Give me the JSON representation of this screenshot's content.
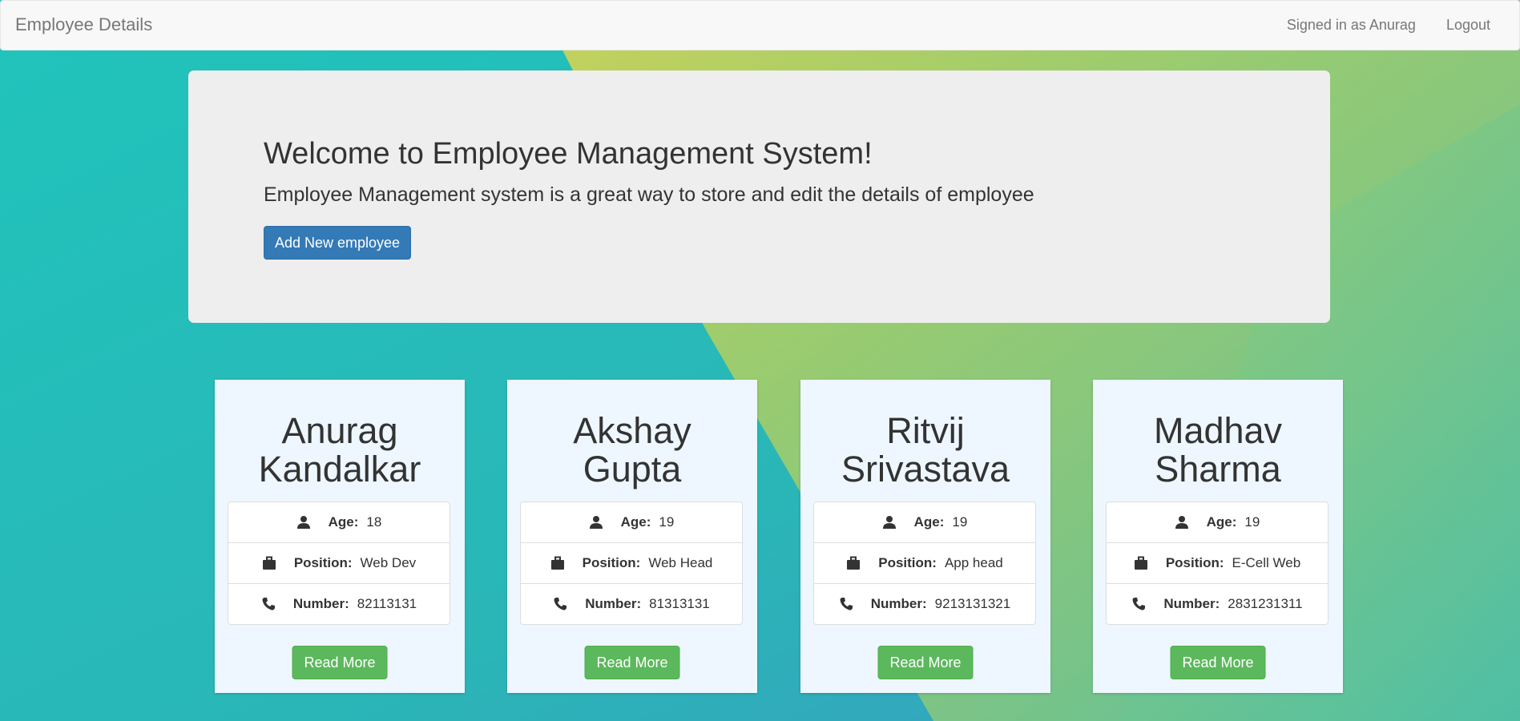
{
  "navbar": {
    "brand": "Employee Details",
    "signed_in": "Signed in as Anurag",
    "logout": "Logout"
  },
  "jumbotron": {
    "title": "Welcome to Employee Management System!",
    "subtitle": "Employee Management system is a great way to store and edit the details of employee",
    "add_button": "Add New employee"
  },
  "labels": {
    "age": "Age:",
    "position": "Position:",
    "number": "Number:",
    "read_more": "Read More"
  },
  "icons": {
    "age": "user-icon",
    "position": "briefcase-icon",
    "number": "phone-icon"
  },
  "colors": {
    "primary": "#337ab7",
    "success": "#5cb85c",
    "card_bg": "#eef7ff",
    "teal": "#24c1bb",
    "green": "#8ac77c"
  },
  "employees": [
    {
      "first_name": "Anurag",
      "last_name": "Kandalkar",
      "age": "18",
      "position": "Web Dev",
      "number": "82113131"
    },
    {
      "first_name": "Akshay",
      "last_name": "Gupta",
      "age": "19",
      "position": "Web Head",
      "number": "81313131"
    },
    {
      "first_name": "Ritvij",
      "last_name": "Srivastava",
      "age": "19",
      "position": "App head",
      "number": "9213131321"
    },
    {
      "first_name": "Madhav",
      "last_name": "Sharma",
      "age": "19",
      "position": "E-Cell Web",
      "number": "2831231311"
    }
  ]
}
